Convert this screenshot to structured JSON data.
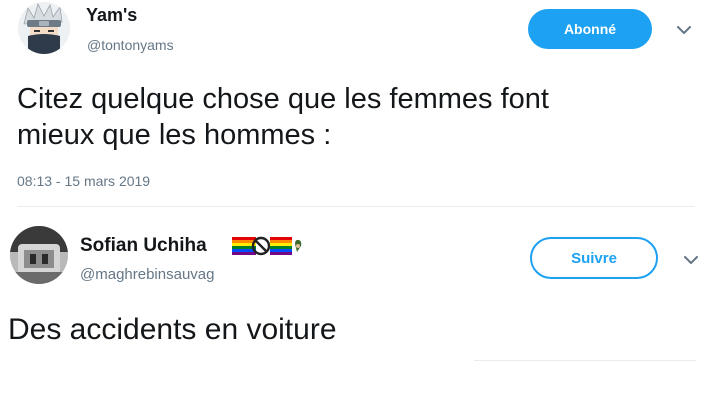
{
  "tweet": {
    "author": {
      "name": "Yam's",
      "handle": "@tontonyams"
    },
    "follow_button": "Abonné",
    "text_line1": "Citez quelque chose que les femmes font",
    "text_line2": "mieux que les hommes :",
    "timestamp": "08:13 - 15 mars 2019"
  },
  "reply": {
    "author": {
      "name": "Sofian Uchiha",
      "handle": "@maghrebinsauvag"
    },
    "follow_button": "Suivre",
    "text": "Des accidents en voiture"
  },
  "colors": {
    "accent": "#1da1f2",
    "text_primary": "#14171a",
    "text_secondary": "#657786",
    "divider": "#e6ecf0"
  },
  "icons": {
    "caret": "chevron-down-icon",
    "flags": [
      "rainbow-flag-icon",
      "no-entry-sign-icon",
      "rainbow-flag-icon",
      "heart-hand-icon"
    ]
  }
}
